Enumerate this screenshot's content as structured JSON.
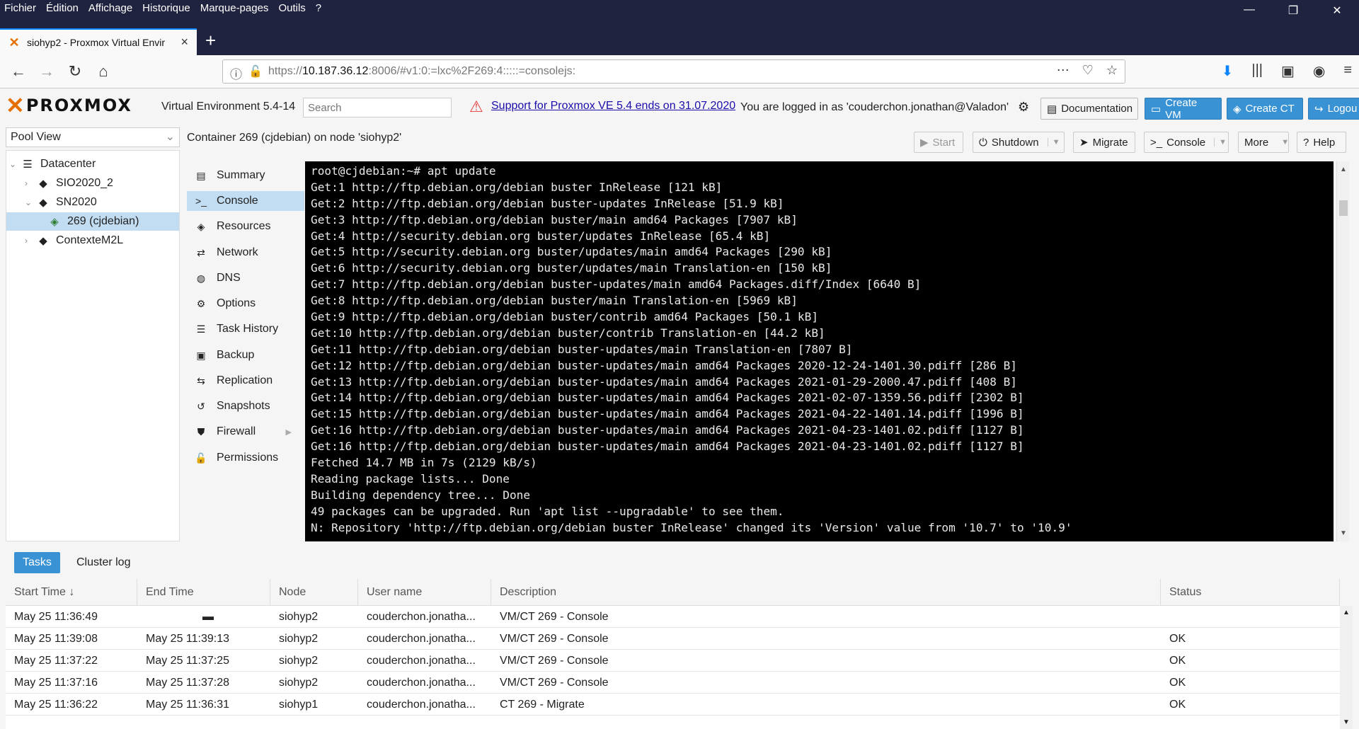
{
  "browser": {
    "menu": [
      "Fichier",
      "Édition",
      "Affichage",
      "Historique",
      "Marque-pages",
      "Outils",
      "?"
    ],
    "tab_title": "siohyp2 - Proxmox Virtual Envir",
    "url_prefix": "https://",
    "url_host": "10.187.36.12",
    "url_rest": ":8006/#v1:0:=lxc%2F269:4:::::=consolejs:"
  },
  "header": {
    "logo": "PROXMOX",
    "version": "Virtual Environment 5.4-14",
    "search_placeholder": "Search",
    "support_link": "Support for Proxmox VE 5.4 ends on 31.07.2020",
    "logged_in": "You are logged in as 'couderchon.jonathan@Valadon'",
    "buttons": {
      "documentation": "Documentation",
      "create_vm": "Create VM",
      "create_ct": "Create CT",
      "logout": "Logou"
    }
  },
  "tree": {
    "view": "Pool View",
    "items": [
      "Datacenter",
      "SIO2020_2",
      "SN2020",
      "269 (cjdebian)",
      "ContexteM2L"
    ]
  },
  "content": {
    "title": "Container 269 (cjdebian) on node 'siohyp2'",
    "buttons": {
      "start": "Start",
      "shutdown": "Shutdown",
      "migrate": "Migrate",
      "console": "Console",
      "more": "More",
      "help": "Help"
    },
    "nav": [
      "Summary",
      "Console",
      "Resources",
      "Network",
      "DNS",
      "Options",
      "Task History",
      "Backup",
      "Replication",
      "Snapshots",
      "Firewall",
      "Permissions"
    ]
  },
  "terminal": [
    "root@cjdebian:~# apt update",
    "Get:1 http://ftp.debian.org/debian buster InRelease [121 kB]",
    "Get:2 http://ftp.debian.org/debian buster-updates InRelease [51.9 kB]",
    "Get:3 http://ftp.debian.org/debian buster/main amd64 Packages [7907 kB]",
    "Get:4 http://security.debian.org buster/updates InRelease [65.4 kB]",
    "Get:5 http://security.debian.org buster/updates/main amd64 Packages [290 kB]",
    "Get:6 http://security.debian.org buster/updates/main Translation-en [150 kB]",
    "Get:7 http://ftp.debian.org/debian buster-updates/main amd64 Packages.diff/Index [6640 B]",
    "Get:8 http://ftp.debian.org/debian buster/main Translation-en [5969 kB]",
    "Get:9 http://ftp.debian.org/debian buster/contrib amd64 Packages [50.1 kB]",
    "Get:10 http://ftp.debian.org/debian buster/contrib Translation-en [44.2 kB]",
    "Get:11 http://ftp.debian.org/debian buster-updates/main Translation-en [7807 B]",
    "Get:12 http://ftp.debian.org/debian buster-updates/main amd64 Packages 2020-12-24-1401.30.pdiff [286 B]",
    "Get:13 http://ftp.debian.org/debian buster-updates/main amd64 Packages 2021-01-29-2000.47.pdiff [408 B]",
    "Get:14 http://ftp.debian.org/debian buster-updates/main amd64 Packages 2021-02-07-1359.56.pdiff [2302 B]",
    "Get:15 http://ftp.debian.org/debian buster-updates/main amd64 Packages 2021-04-22-1401.14.pdiff [1996 B]",
    "Get:16 http://ftp.debian.org/debian buster-updates/main amd64 Packages 2021-04-23-1401.02.pdiff [1127 B]",
    "Get:16 http://ftp.debian.org/debian buster-updates/main amd64 Packages 2021-04-23-1401.02.pdiff [1127 B]",
    "Fetched 14.7 MB in 7s (2129 kB/s)",
    "Reading package lists... Done",
    "Building dependency tree... Done",
    "49 packages can be upgraded. Run 'apt list --upgradable' to see them.",
    "N: Repository 'http://ftp.debian.org/debian buster InRelease' changed its 'Version' value from '10.7' to '10.9'"
  ],
  "bottom": {
    "tabs": [
      "Tasks",
      "Cluster log"
    ],
    "columns": [
      "Start Time",
      "End Time",
      "Node",
      "User name",
      "Description",
      "Status"
    ],
    "rows": [
      [
        "May 25 11:36:49",
        "",
        "siohyp2",
        "couderchon.jonatha...",
        "VM/CT 269 - Console",
        ""
      ],
      [
        "May 25 11:39:08",
        "May 25 11:39:13",
        "siohyp2",
        "couderchon.jonatha...",
        "VM/CT 269 - Console",
        "OK"
      ],
      [
        "May 25 11:37:22",
        "May 25 11:37:25",
        "siohyp2",
        "couderchon.jonatha...",
        "VM/CT 269 - Console",
        "OK"
      ],
      [
        "May 25 11:37:16",
        "May 25 11:37:28",
        "siohyp2",
        "couderchon.jonatha...",
        "VM/CT 269 - Console",
        "OK"
      ],
      [
        "May 25 11:36:22",
        "May 25 11:36:31",
        "siohyp1",
        "couderchon.jonatha...",
        "CT 269 - Migrate",
        "OK"
      ]
    ]
  },
  "colors": {
    "accent": "#3892d4",
    "selected": "#c2ddf2",
    "brand_orange": "#e57000",
    "firefox_dark": "#202340"
  }
}
